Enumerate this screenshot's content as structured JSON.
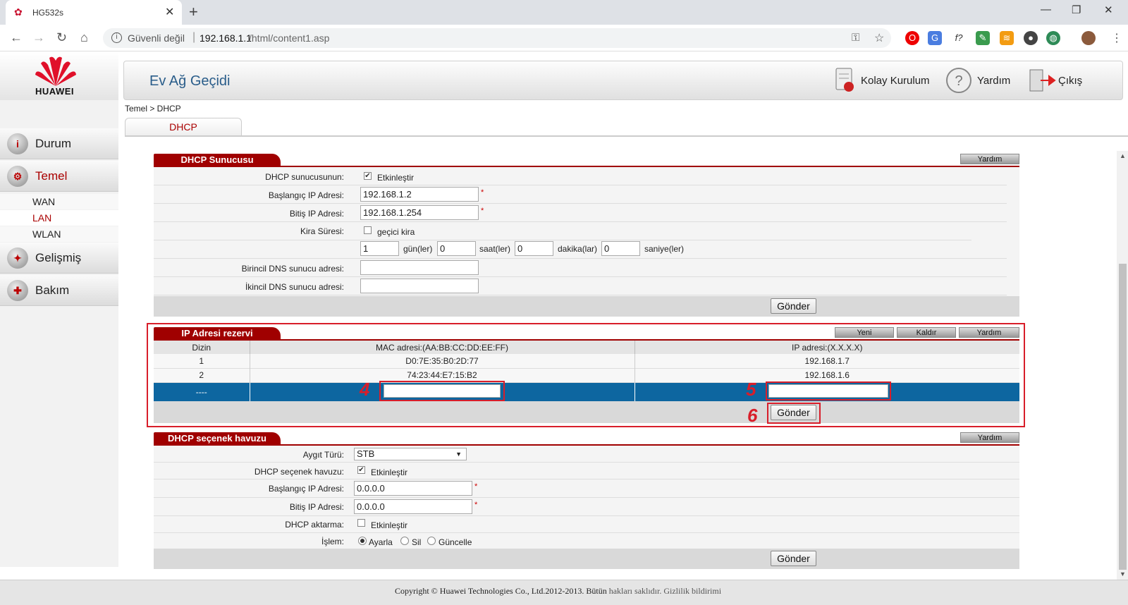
{
  "browser": {
    "tab_title": "HG532s",
    "security_label": "Güvenli değil",
    "url_host": "192.168.1.1",
    "url_path": "/html/content1.asp",
    "ext_f": "f?"
  },
  "brand": {
    "logo_text": "HUAWEI",
    "accent": "#a00000"
  },
  "header": {
    "title": "Ev Ağ Geçidi",
    "quick_setup": "Kolay Kurulum",
    "help": "Yardım",
    "logout": "Çıkış"
  },
  "sidebar": {
    "items": [
      {
        "label": "Durum"
      },
      {
        "label": "Temel"
      },
      {
        "label": "Gelişmiş"
      },
      {
        "label": "Bakım"
      }
    ],
    "subitems": [
      {
        "label": "WAN"
      },
      {
        "label": "LAN"
      },
      {
        "label": "WLAN"
      }
    ]
  },
  "breadcrumb": "Temel > DHCP",
  "tab": "DHCP",
  "dhcp_server": {
    "title": "DHCP Sunucusu",
    "help": "Yardım",
    "enable_label": "DHCP sunucusunun:",
    "enable_text": "Etkinleştir",
    "start_label": "Başlangıç IP Adresi:",
    "start_value": "192.168.1.2",
    "end_label": "Bitiş IP Adresi:",
    "end_value": "192.168.1.254",
    "lease_label": "Kira Süresi:",
    "temp_lease": "geçici kira",
    "days": "1",
    "days_unit": "gün(ler)",
    "hours": "0",
    "hours_unit": "saat(ler)",
    "minutes": "0",
    "minutes_unit": "dakika(lar)",
    "seconds": "0",
    "seconds_unit": "saniye(ler)",
    "dns1_label": "Birincil DNS sunucu adresi:",
    "dns2_label": "İkincil DNS sunucu adresi:",
    "submit": "Gönder",
    "star": "*"
  },
  "ip_reserve": {
    "title": "IP Adresi rezervi",
    "new": "Yeni",
    "remove": "Kaldır",
    "help": "Yardım",
    "columns": [
      "Dizin",
      "MAC adresi:(AA:BB:CC:DD:EE:FF)",
      "IP adresi:(X.X.X.X)"
    ],
    "rows": [
      {
        "index": "1",
        "mac": "D0:7E:35:B0:2D:77",
        "ip": "192.168.1.7"
      },
      {
        "index": "2",
        "mac": "74:23:44:E7:15:B2",
        "ip": "192.168.1.6"
      }
    ],
    "new_row_index": "----",
    "submit": "Gönder",
    "markers": [
      "4",
      "5",
      "6"
    ]
  },
  "option_pool": {
    "title": "DHCP seçenek havuzu",
    "help": "Yardım",
    "device_label": "Aygıt Türü:",
    "device_value": "STB",
    "pool_label": "DHCP seçenek havuzu:",
    "pool_text": "Etkinleştir",
    "start_label": "Başlangıç IP Adresi:",
    "start_value": "0.0.0.0",
    "end_label": "Bitiş IP Adresi:",
    "end_value": "0.0.0.0",
    "relay_label": "DHCP aktarma:",
    "relay_text": "Etkinleştir",
    "action_label": "İşlem:",
    "action_set": "Ayarla",
    "action_delete": "Sil",
    "action_update": "Güncelle",
    "submit": "Gönder",
    "star": "*"
  },
  "footer": {
    "copyright": "Copyright © Huawei Technologies Co., Ltd.2012-2013. Bütün",
    "rights_link": "hakları saklıdır.",
    "privacy_link": "Gizlilik bildirimi"
  }
}
